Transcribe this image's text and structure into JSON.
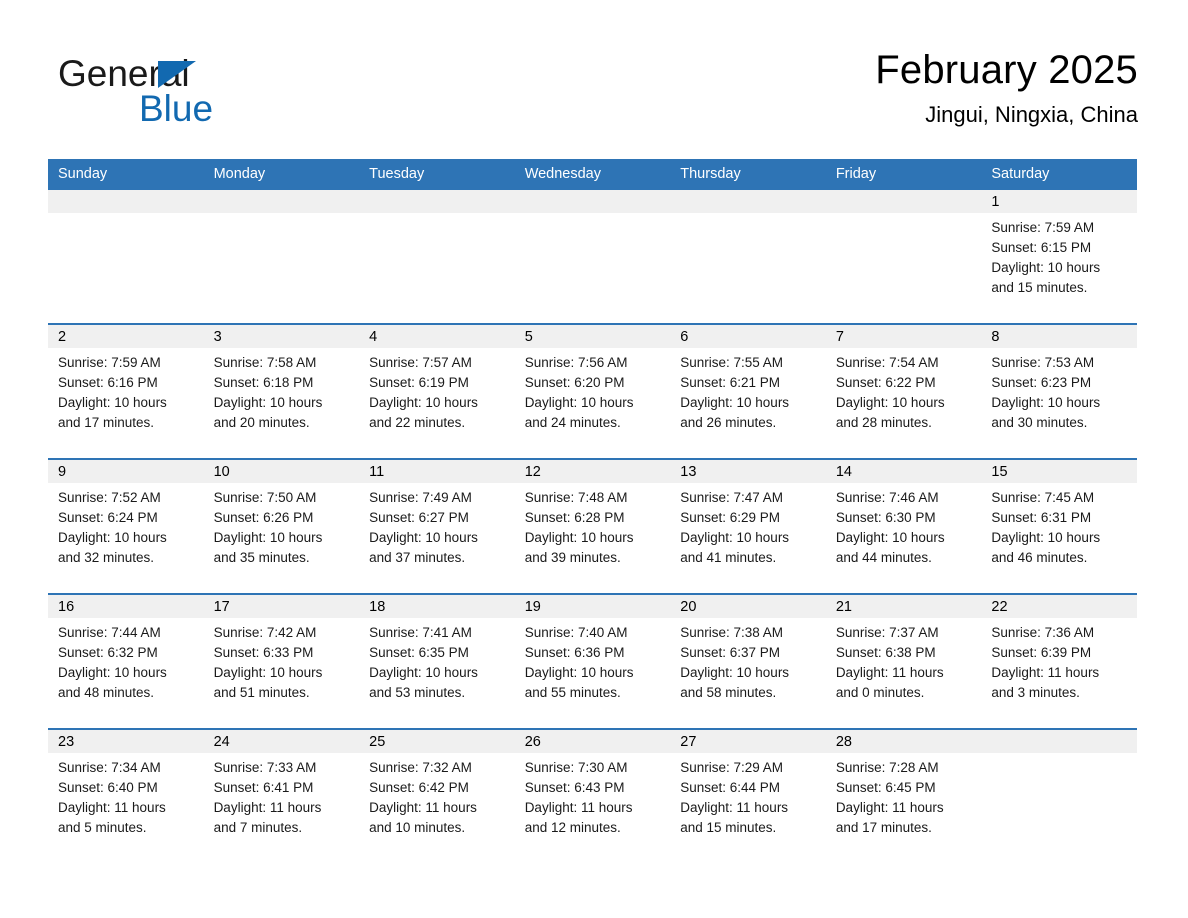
{
  "brand": {
    "logo_line1": "General",
    "logo_line2": "Blue",
    "triangle_icon": "triangle-icon",
    "accent_color": "#1269b0"
  },
  "header": {
    "title": "February 2025",
    "subtitle": "Jingui, Ningxia, China"
  },
  "theme": {
    "header_bar_color": "#2e74b5",
    "row_divider_color": "#2e74b5",
    "daynum_strip_color": "#f0f0f0"
  },
  "weekday_headers": [
    "Sunday",
    "Monday",
    "Tuesday",
    "Wednesday",
    "Thursday",
    "Friday",
    "Saturday"
  ],
  "weeks": [
    [
      {
        "day": "",
        "sunrise": "",
        "sunset": "",
        "daylight": "",
        "daylight2": "",
        "empty": true
      },
      {
        "day": "",
        "sunrise": "",
        "sunset": "",
        "daylight": "",
        "daylight2": "",
        "empty": true
      },
      {
        "day": "",
        "sunrise": "",
        "sunset": "",
        "daylight": "",
        "daylight2": "",
        "empty": true
      },
      {
        "day": "",
        "sunrise": "",
        "sunset": "",
        "daylight": "",
        "daylight2": "",
        "empty": true
      },
      {
        "day": "",
        "sunrise": "",
        "sunset": "",
        "daylight": "",
        "daylight2": "",
        "empty": true
      },
      {
        "day": "",
        "sunrise": "",
        "sunset": "",
        "daylight": "",
        "daylight2": "",
        "empty": true
      },
      {
        "day": "1",
        "sunrise": "Sunrise: 7:59 AM",
        "sunset": "Sunset: 6:15 PM",
        "daylight": "Daylight: 10 hours",
        "daylight2": "and 15 minutes.",
        "empty": false
      }
    ],
    [
      {
        "day": "2",
        "sunrise": "Sunrise: 7:59 AM",
        "sunset": "Sunset: 6:16 PM",
        "daylight": "Daylight: 10 hours",
        "daylight2": "and 17 minutes.",
        "empty": false
      },
      {
        "day": "3",
        "sunrise": "Sunrise: 7:58 AM",
        "sunset": "Sunset: 6:18 PM",
        "daylight": "Daylight: 10 hours",
        "daylight2": "and 20 minutes.",
        "empty": false
      },
      {
        "day": "4",
        "sunrise": "Sunrise: 7:57 AM",
        "sunset": "Sunset: 6:19 PM",
        "daylight": "Daylight: 10 hours",
        "daylight2": "and 22 minutes.",
        "empty": false
      },
      {
        "day": "5",
        "sunrise": "Sunrise: 7:56 AM",
        "sunset": "Sunset: 6:20 PM",
        "daylight": "Daylight: 10 hours",
        "daylight2": "and 24 minutes.",
        "empty": false
      },
      {
        "day": "6",
        "sunrise": "Sunrise: 7:55 AM",
        "sunset": "Sunset: 6:21 PM",
        "daylight": "Daylight: 10 hours",
        "daylight2": "and 26 minutes.",
        "empty": false
      },
      {
        "day": "7",
        "sunrise": "Sunrise: 7:54 AM",
        "sunset": "Sunset: 6:22 PM",
        "daylight": "Daylight: 10 hours",
        "daylight2": "and 28 minutes.",
        "empty": false
      },
      {
        "day": "8",
        "sunrise": "Sunrise: 7:53 AM",
        "sunset": "Sunset: 6:23 PM",
        "daylight": "Daylight: 10 hours",
        "daylight2": "and 30 minutes.",
        "empty": false
      }
    ],
    [
      {
        "day": "9",
        "sunrise": "Sunrise: 7:52 AM",
        "sunset": "Sunset: 6:24 PM",
        "daylight": "Daylight: 10 hours",
        "daylight2": "and 32 minutes.",
        "empty": false
      },
      {
        "day": "10",
        "sunrise": "Sunrise: 7:50 AM",
        "sunset": "Sunset: 6:26 PM",
        "daylight": "Daylight: 10 hours",
        "daylight2": "and 35 minutes.",
        "empty": false
      },
      {
        "day": "11",
        "sunrise": "Sunrise: 7:49 AM",
        "sunset": "Sunset: 6:27 PM",
        "daylight": "Daylight: 10 hours",
        "daylight2": "and 37 minutes.",
        "empty": false
      },
      {
        "day": "12",
        "sunrise": "Sunrise: 7:48 AM",
        "sunset": "Sunset: 6:28 PM",
        "daylight": "Daylight: 10 hours",
        "daylight2": "and 39 minutes.",
        "empty": false
      },
      {
        "day": "13",
        "sunrise": "Sunrise: 7:47 AM",
        "sunset": "Sunset: 6:29 PM",
        "daylight": "Daylight: 10 hours",
        "daylight2": "and 41 minutes.",
        "empty": false
      },
      {
        "day": "14",
        "sunrise": "Sunrise: 7:46 AM",
        "sunset": "Sunset: 6:30 PM",
        "daylight": "Daylight: 10 hours",
        "daylight2": "and 44 minutes.",
        "empty": false
      },
      {
        "day": "15",
        "sunrise": "Sunrise: 7:45 AM",
        "sunset": "Sunset: 6:31 PM",
        "daylight": "Daylight: 10 hours",
        "daylight2": "and 46 minutes.",
        "empty": false
      }
    ],
    [
      {
        "day": "16",
        "sunrise": "Sunrise: 7:44 AM",
        "sunset": "Sunset: 6:32 PM",
        "daylight": "Daylight: 10 hours",
        "daylight2": "and 48 minutes.",
        "empty": false
      },
      {
        "day": "17",
        "sunrise": "Sunrise: 7:42 AM",
        "sunset": "Sunset: 6:33 PM",
        "daylight": "Daylight: 10 hours",
        "daylight2": "and 51 minutes.",
        "empty": false
      },
      {
        "day": "18",
        "sunrise": "Sunrise: 7:41 AM",
        "sunset": "Sunset: 6:35 PM",
        "daylight": "Daylight: 10 hours",
        "daylight2": "and 53 minutes.",
        "empty": false
      },
      {
        "day": "19",
        "sunrise": "Sunrise: 7:40 AM",
        "sunset": "Sunset: 6:36 PM",
        "daylight": "Daylight: 10 hours",
        "daylight2": "and 55 minutes.",
        "empty": false
      },
      {
        "day": "20",
        "sunrise": "Sunrise: 7:38 AM",
        "sunset": "Sunset: 6:37 PM",
        "daylight": "Daylight: 10 hours",
        "daylight2": "and 58 minutes.",
        "empty": false
      },
      {
        "day": "21",
        "sunrise": "Sunrise: 7:37 AM",
        "sunset": "Sunset: 6:38 PM",
        "daylight": "Daylight: 11 hours",
        "daylight2": "and 0 minutes.",
        "empty": false
      },
      {
        "day": "22",
        "sunrise": "Sunrise: 7:36 AM",
        "sunset": "Sunset: 6:39 PM",
        "daylight": "Daylight: 11 hours",
        "daylight2": "and 3 minutes.",
        "empty": false
      }
    ],
    [
      {
        "day": "23",
        "sunrise": "Sunrise: 7:34 AM",
        "sunset": "Sunset: 6:40 PM",
        "daylight": "Daylight: 11 hours",
        "daylight2": "and 5 minutes.",
        "empty": false
      },
      {
        "day": "24",
        "sunrise": "Sunrise: 7:33 AM",
        "sunset": "Sunset: 6:41 PM",
        "daylight": "Daylight: 11 hours",
        "daylight2": "and 7 minutes.",
        "empty": false
      },
      {
        "day": "25",
        "sunrise": "Sunrise: 7:32 AM",
        "sunset": "Sunset: 6:42 PM",
        "daylight": "Daylight: 11 hours",
        "daylight2": "and 10 minutes.",
        "empty": false
      },
      {
        "day": "26",
        "sunrise": "Sunrise: 7:30 AM",
        "sunset": "Sunset: 6:43 PM",
        "daylight": "Daylight: 11 hours",
        "daylight2": "and 12 minutes.",
        "empty": false
      },
      {
        "day": "27",
        "sunrise": "Sunrise: 7:29 AM",
        "sunset": "Sunset: 6:44 PM",
        "daylight": "Daylight: 11 hours",
        "daylight2": "and 15 minutes.",
        "empty": false
      },
      {
        "day": "28",
        "sunrise": "Sunrise: 7:28 AM",
        "sunset": "Sunset: 6:45 PM",
        "daylight": "Daylight: 11 hours",
        "daylight2": "and 17 minutes.",
        "empty": false
      },
      {
        "day": "",
        "sunrise": "",
        "sunset": "",
        "daylight": "",
        "daylight2": "",
        "empty": true
      }
    ]
  ]
}
